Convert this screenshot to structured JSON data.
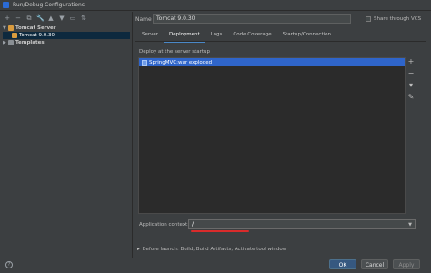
{
  "window": {
    "title": "Run/Debug Configurations"
  },
  "toolbar": {
    "icons": [
      "add-icon",
      "remove-icon",
      "copy-icon",
      "wrench-icon",
      "move-up-icon",
      "move-down-icon",
      "folder-icon",
      "sort-icon"
    ],
    "glyphs": [
      "+",
      "−",
      "⧉",
      "🔧",
      "▲",
      "▼",
      "▭",
      "⇅"
    ]
  },
  "tree": {
    "group": "Tomcat Server",
    "item": "Tomcat 9.0.30",
    "templates": "Templates"
  },
  "form": {
    "name_label": "Name",
    "name_value": "Tomcat 9.0.30",
    "share_label": "Share through VCS"
  },
  "tabs": [
    "Server",
    "Deployment",
    "Logs",
    "Code Coverage",
    "Startup/Connection"
  ],
  "deployment": {
    "label": "Deploy at the server startup",
    "items": [
      "SpringMVC:war exploded"
    ],
    "side_buttons": [
      "+",
      "−",
      "▾",
      "✎"
    ]
  },
  "context": {
    "label": "Application context:",
    "value": "/"
  },
  "before_launch": {
    "arrow": "▸",
    "text": "Before launch: Build, Build Artifacts, Activate tool window"
  },
  "buttons": {
    "help": "?",
    "ok": "OK",
    "cancel": "Cancel",
    "apply": "Apply"
  }
}
